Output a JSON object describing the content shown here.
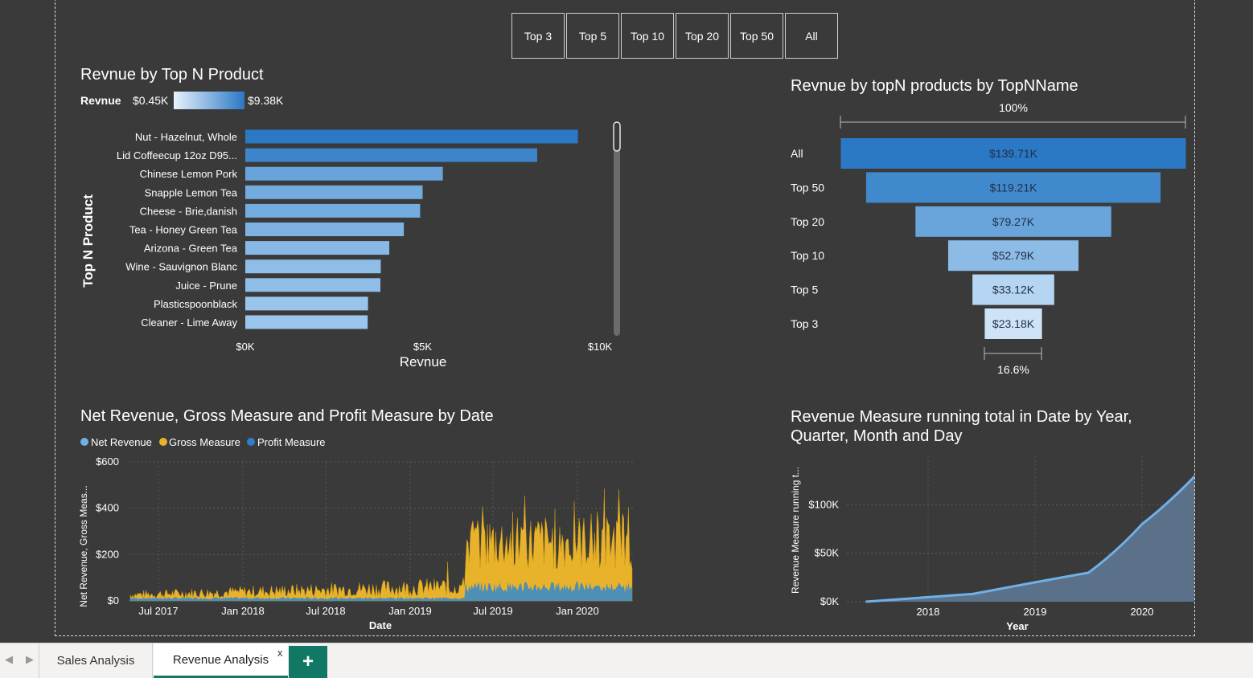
{
  "slicer": {
    "buttons": [
      "Top 3",
      "Top 5",
      "Top 10",
      "Top 20",
      "Top 50",
      "All"
    ]
  },
  "bar_chart": {
    "title": "Revnue by Top N Product",
    "legend_label": "Revnue",
    "legend_min": "$0.45K",
    "legend_max": "$9.38K",
    "ylabel": "Top N Product",
    "xlabel": "Revnue",
    "xticks": [
      "$0K",
      "$5K",
      "$10K"
    ]
  },
  "funnel_chart": {
    "title": "Revnue by topN products by TopNName",
    "top_pct": "100%",
    "bottom_pct": "16.6%"
  },
  "line_chart": {
    "title": "Net Revenue, Gross Measure and Profit Measure by Date",
    "legend": [
      "Net Revenue",
      "Gross Measure",
      "Profit Measure"
    ],
    "ylabel": "Net Revenue, Gross Meas...",
    "xlabel": "Date",
    "yticks": [
      "$600",
      "$400",
      "$200",
      "$0"
    ],
    "xticks": [
      "Jul 2017",
      "Jan 2018",
      "Jul 2018",
      "Jan 2019",
      "Jul 2019",
      "Jan 2020"
    ]
  },
  "area_chart": {
    "title_line1": "Revenue Measure running total in Date by Year,",
    "title_line2": "Quarter, Month and Day",
    "ylabel": "Revenue Measure running t...",
    "xlabel": "Year",
    "yticks": [
      "$100K",
      "$50K",
      "$0K"
    ],
    "xticks": [
      "2018",
      "2019",
      "2020"
    ]
  },
  "tabs": {
    "sheet1": "Sales Analysis",
    "sheet2": "Revenue Analysis",
    "close": "x",
    "add": "+"
  },
  "colors": {
    "background": "#3a3a3a",
    "bar_dark": "#2b78c5",
    "bar_light": "#9ac5ec",
    "gross": "#e8b22b",
    "profit": "#2f7fc8",
    "net": "#6fb0e8",
    "tab_accent": "#117865"
  },
  "chart_data": [
    {
      "type": "bar",
      "orientation": "horizontal",
      "title": "Revnue by Top N Product",
      "categories": [
        "Nut - Hazelnut, Whole",
        "Lid Coffeecup 12oz D95...",
        "Chinese Lemon Pork",
        "Snapple Lemon Tea",
        "Cheese - Brie,danish",
        "Tea - Honey Green Tea",
        "Arizona - Green Tea",
        "Wine - Sauvignon Blanc",
        "Juice - Prune",
        "Plasticspoonblack",
        "Cleaner - Lime Away"
      ],
      "values": [
        9380,
        8230,
        5570,
        5000,
        4930,
        4470,
        4060,
        3820,
        3810,
        3460,
        3450
      ],
      "xlabel": "Revnue",
      "ylabel": "Top N Product",
      "xlim": [
        0,
        10000
      ]
    },
    {
      "type": "funnel",
      "title": "Revnue by topN products by TopNName",
      "categories": [
        "All",
        "Top 50",
        "Top 20",
        "Top 10",
        "Top 5",
        "Top 3"
      ],
      "values": [
        139.71,
        119.21,
        79.27,
        52.79,
        33.12,
        23.18
      ],
      "labels": [
        "$139.71K",
        "$119.21K",
        "$79.27K",
        "$52.79K",
        "$33.12K",
        "$23.18K"
      ]
    },
    {
      "type": "area",
      "title": "Net Revenue, Gross Measure and Profit Measure by Date",
      "series": [
        {
          "name": "Gross Measure",
          "segments": [
            {
              "from": "Jun 2017",
              "to": "Jun 2019",
              "typical": 50,
              "peak": 230
            },
            {
              "from": "Jun 2019",
              "to": "Jun 2020",
              "typical": 270,
              "peak": 500
            }
          ]
        },
        {
          "name": "Profit Measure",
          "segments": [
            {
              "from": "Jun 2017",
              "to": "Jun 2019",
              "typical": 12
            },
            {
              "from": "Jun 2019",
              "to": "Jun 2020",
              "typical": 60
            }
          ]
        },
        {
          "name": "Net Revenue",
          "segments": []
        }
      ],
      "ylim": [
        0,
        600
      ],
      "xlabel": "Date"
    },
    {
      "type": "area",
      "title": "Revenue Measure running total in Date by Year, Quarter, Month and Day",
      "x": [
        "2017-06",
        "2018-06",
        "2019-01",
        "2019-07",
        "2020-01",
        "2020-08"
      ],
      "values": [
        0,
        8000,
        20000,
        30000,
        80000,
        140000
      ],
      "xlabel": "Year",
      "ylim": [
        0,
        150000
      ]
    }
  ]
}
